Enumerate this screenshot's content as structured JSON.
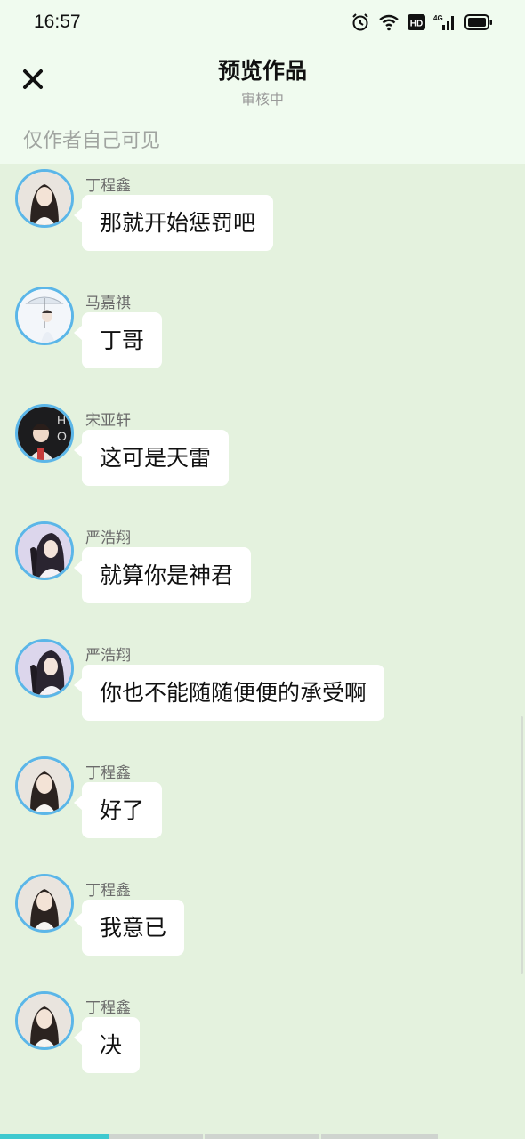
{
  "status": {
    "time": "16:57",
    "icons": [
      "alarm-icon",
      "wifi-icon",
      "hd-icon",
      "4g-signal-icon",
      "battery-icon"
    ],
    "hd_label": "HD",
    "net_label": "4G"
  },
  "header": {
    "close_icon": "close-icon",
    "title": "预览作品",
    "subtitle": "审核中",
    "visibility": "仅作者自己可见"
  },
  "colors": {
    "background": "#e4f2de",
    "header_background": "#f0fbef",
    "avatar_border": "#5bb6e8",
    "bubble": "#ffffff",
    "progress_fill": "#3ec9cf"
  },
  "messages": [
    {
      "sender": "丁程鑫",
      "text": "那就开始惩罚吧",
      "avatar": "avatar-ding"
    },
    {
      "sender": "马嘉祺",
      "text": "丁哥",
      "avatar": "avatar-ma"
    },
    {
      "sender": "宋亚轩",
      "text": "这可是天雷",
      "avatar": "avatar-song"
    },
    {
      "sender": "严浩翔",
      "text": "就算你是神君",
      "avatar": "avatar-yan"
    },
    {
      "sender": "严浩翔",
      "text": "你也不能随随便便的承受啊",
      "avatar": "avatar-yan"
    },
    {
      "sender": "丁程鑫",
      "text": "好了",
      "avatar": "avatar-ding"
    },
    {
      "sender": "丁程鑫",
      "text": "我意已",
      "avatar": "avatar-ding"
    },
    {
      "sender": "丁程鑫",
      "text": "决",
      "avatar": "avatar-ding"
    }
  ],
  "progress": {
    "segments": 4,
    "filled_fraction_first_segment": 1.0
  }
}
